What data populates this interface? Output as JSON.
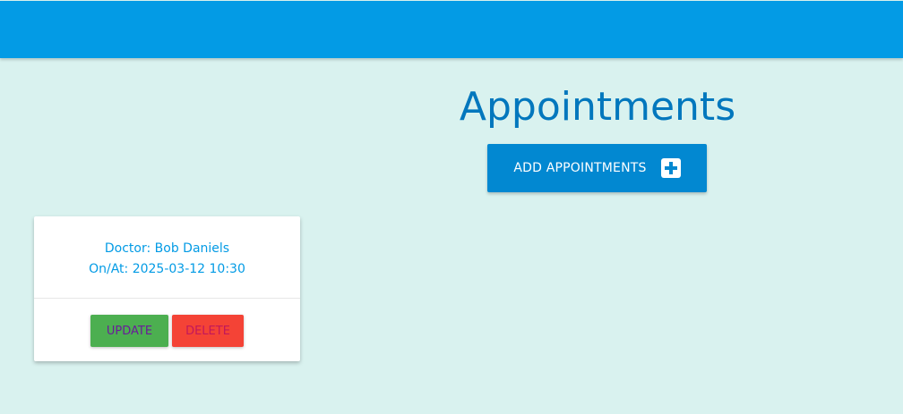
{
  "colors": {
    "topbar": "#039be5",
    "background": "#d9f2ef",
    "title": "#0277bd",
    "add_button": "#0288d1",
    "update_button": "#4caf50",
    "delete_button": "#f44336"
  },
  "page": {
    "title": "Appointments"
  },
  "add_button": {
    "label": "ADD APPOINTMENTS",
    "icon": "plus-square-icon"
  },
  "appointments": [
    {
      "doctor_line": "Doctor: Bob Daniels",
      "datetime_line": "On/At: 2025-03-12 10:30",
      "update_label": "UPDATE",
      "delete_label": "DELETE"
    }
  ]
}
